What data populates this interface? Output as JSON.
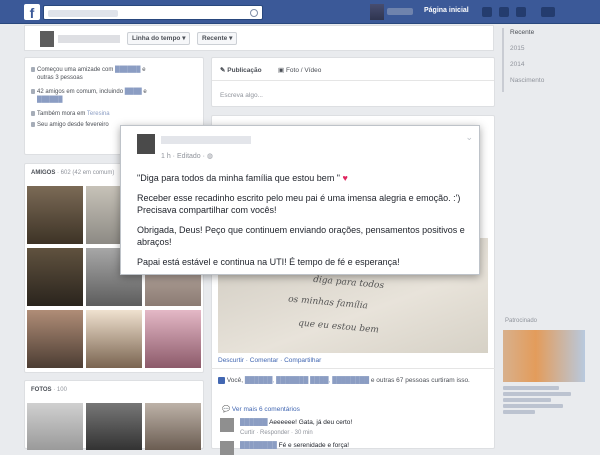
{
  "topbar": {
    "logo": "f",
    "home_link": "Página inicial",
    "icons": [
      "friend-requests-icon",
      "messages-icon",
      "notifications-icon",
      "settings-icon"
    ]
  },
  "profile_nav": {
    "timeline_label": "Linha do tempo",
    "recent_label": "Recente"
  },
  "years_nav": {
    "items": [
      "Recente",
      "2015",
      "2014",
      "Nascimento"
    ]
  },
  "intro": {
    "row1_a": "Começou uma amizade com",
    "row1_b": "e",
    "row1_c": "outras 3 pessoas",
    "row2_a": "42 amigos em comum, incluindo",
    "row2_b": "e",
    "row3": "Também mora em",
    "row3_city": "Teresina",
    "row4": "Seu amigo desde fevereiro"
  },
  "friends": {
    "title": "AMIGOS",
    "count": "· 602 (42 em comum)"
  },
  "photos": {
    "title": "FOTOS",
    "count": "· 100"
  },
  "composer": {
    "tab_post": "Publicação",
    "tab_photo": "Foto / Vídeo",
    "placeholder": "Escreva algo..."
  },
  "post": {
    "meta": "1 h · Editado · ",
    "line1": "\"Diga para todos da minha família que estou bem \"",
    "heart": "♥",
    "para2": "Receber esse recadinho escrito pelo meu pai é uma imensa alegria e emoção. :') Precisava compartilhar com vocês!",
    "para3": "Obrigada, Deus! Peço que continuem enviando orações, pensamentos positivos e abraços!",
    "para4": "Papai está estável e continua na UTI! É tempo de fé e esperança!",
    "handwriting": [
      "diga para todos",
      "os minhas família",
      "que eu estou bem"
    ],
    "actions": "Descurtir · Comentar · Compartilhar",
    "likes_prefix": "Você,",
    "likes_suffix": "e outras 67 pessoas curtiram isso.",
    "view_more": "Ver mais 6 comentários",
    "comment1_text": "Aeeeeee! Gata, já deu certo!",
    "comment1_meta": "Curtir · Responder · 30 min",
    "comment2_text": "Fé e serenidade e força!"
  },
  "sidebar_ad": {
    "title": "Patrocinado"
  }
}
